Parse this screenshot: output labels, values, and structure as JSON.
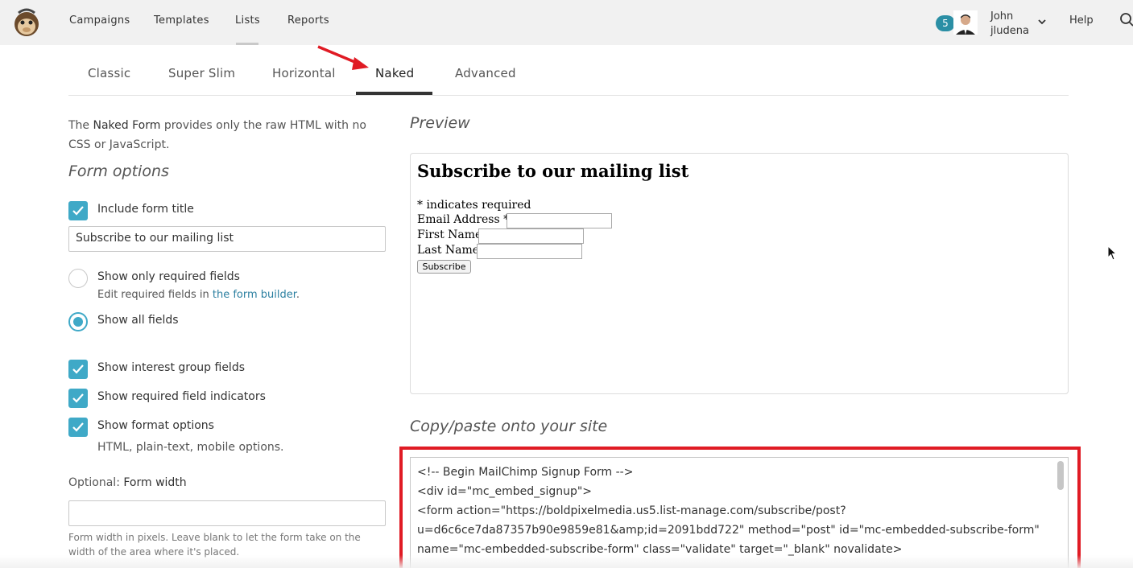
{
  "nav": {
    "items": [
      "Campaigns",
      "Templates",
      "Lists",
      "Reports"
    ],
    "notification_count": "5",
    "user_first": "John",
    "user_handle": "jludena",
    "help": "Help"
  },
  "tabs": [
    "Classic",
    "Super Slim",
    "Horizontal",
    "Naked",
    "Advanced"
  ],
  "active_tab": "Naked",
  "left": {
    "intro_prefix": "The ",
    "intro_bold": "Naked Form",
    "intro_suffix": " provides only the raw HTML with no CSS or JavaScript.",
    "form_options_heading": "Form options",
    "include_title_label": "Include form title",
    "title_input_value": "Subscribe to our mailing list",
    "required_only_label": "Show only required fields",
    "required_hint_prefix": "Edit required fields in ",
    "required_hint_link": "the form builder",
    "required_hint_suffix": ".",
    "show_all_label": "Show all fields",
    "interest_label": "Show interest group fields",
    "indicators_label": "Show required field indicators",
    "format_label": "Show format options",
    "format_hint": "HTML, plain-text, mobile options.",
    "width_label_prefix": "Optional: ",
    "width_label_bold": "Form width",
    "width_note": "Form width in pixels. Leave blank to let the form take on the width of the area where it's placed."
  },
  "preview": {
    "heading": "Preview",
    "title": "Subscribe to our mailing list",
    "required_note": "* indicates required",
    "email_label": "Email Address *",
    "first_name_label": "First Name",
    "last_name_label": "Last Name",
    "button": "Subscribe"
  },
  "code": {
    "heading": "Copy/paste onto your site",
    "lines": [
      "<!-- Begin MailChimp Signup Form -->",
      "<div id=\"mc_embed_signup\">",
      "<form action=\"https://boldpixelmedia.us5.list-manage.com/subscribe/post?",
      "u=d6c6ce7da87357b90e9859e81&amp;id=2091bdd722\" method=\"post\" id=\"mc-embedded-subscribe-form\"",
      "name=\"mc-embedded-subscribe-form\" class=\"validate\" target=\"_blank\" novalidate>"
    ]
  },
  "colors": {
    "accent": "#3fa9c7",
    "highlight_red": "#e01b24",
    "link": "#2b7fa0"
  }
}
